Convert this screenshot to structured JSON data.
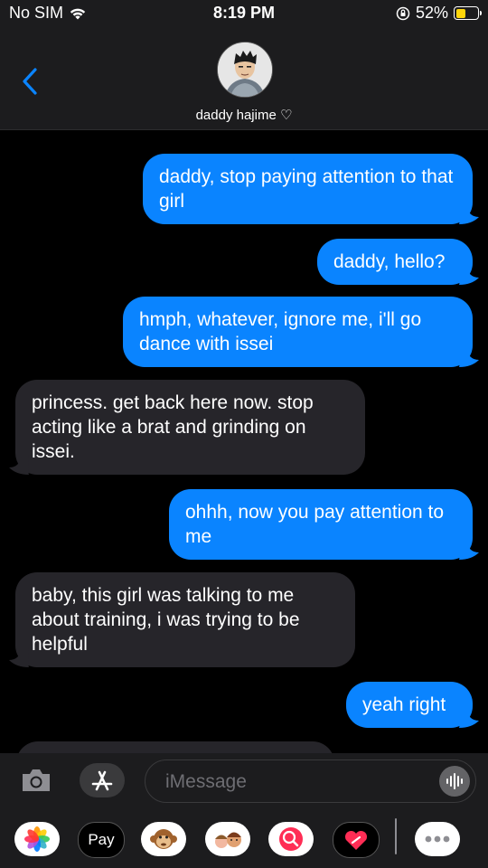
{
  "status": {
    "carrier": "No SIM",
    "time": "8:19 PM",
    "battery": "52%",
    "battery_level": 0.52
  },
  "header": {
    "contact_name": "daddy hajime ♡"
  },
  "messages": [
    {
      "from": "me",
      "text": "daddy, stop paying attention to that girl"
    },
    {
      "from": "me",
      "text": "daddy, hello?"
    },
    {
      "from": "me",
      "text": "hmph, whatever, ignore me, i'll go dance with issei"
    },
    {
      "from": "them",
      "text": "princess. get back here now. stop acting like a brat and grinding on issei."
    },
    {
      "from": "me",
      "text": "ohhh, now you pay attention to me"
    },
    {
      "from": "them",
      "text": "baby, this girl was talking to me about training, i was trying to be helpful"
    },
    {
      "from": "me",
      "text": "yeah right"
    }
  ],
  "composer": {
    "placeholder": "iMessage"
  },
  "drawer": {
    "applepay_label": "Pay"
  },
  "colors": {
    "sent": "#0a84ff",
    "received": "#26252a",
    "background": "#000000",
    "battery": "#ffd60a"
  }
}
